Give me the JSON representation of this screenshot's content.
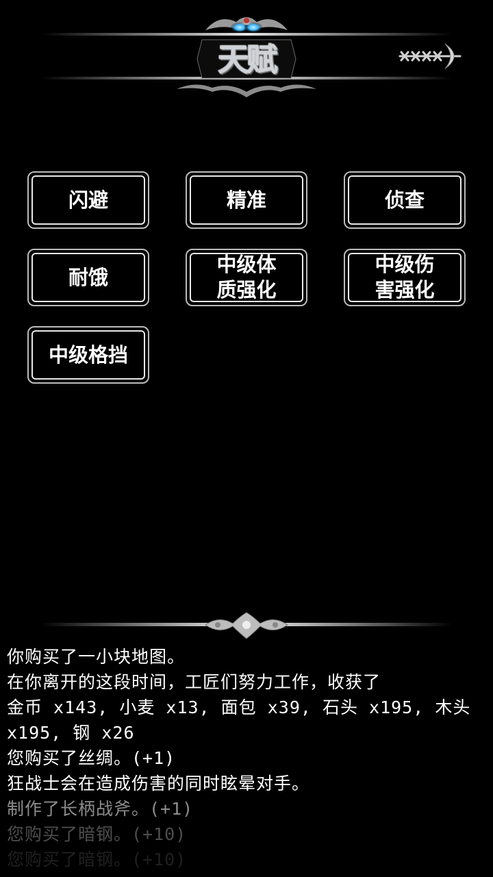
{
  "header": {
    "title": "天赋",
    "close_icon": "arrow-close-icon"
  },
  "talents": [
    {
      "label": "闪避"
    },
    {
      "label": "精准"
    },
    {
      "label": "侦查"
    },
    {
      "label": "耐饿"
    },
    {
      "label": "中级体\n质强化"
    },
    {
      "label": "中级伤\n害强化"
    },
    {
      "label": "中级格挡"
    }
  ],
  "log": {
    "lines": [
      "你购买了一小块地图。",
      "在你离开的这段时间，工匠们努力工作，收获了",
      "金币 x143, 小麦 x13, 面包 x39, 石头 x195, 木头",
      "x195, 钢 x26",
      "您购买了丝绸。(+1)",
      "狂战士会在造成伤害的同时眩晕对手。",
      "制作了长柄战斧。(+1)",
      "您购买了暗钢。(+10)",
      "您购买了暗钢。(+10)"
    ]
  },
  "colors": {
    "background": "#000000",
    "text": "#ffffff",
    "button_border": "#e8e8e8",
    "ornament": "#c8c8c8",
    "glow": "#5fd3ff"
  }
}
